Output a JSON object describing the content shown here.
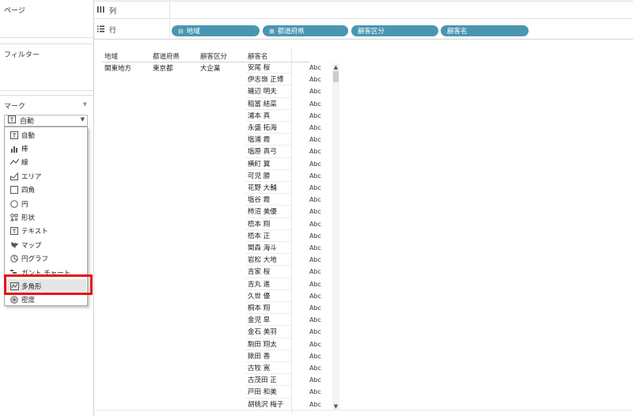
{
  "left_pane": {
    "pages_title": "ページ",
    "filters_title": "フィルター",
    "marks_title": "マーク",
    "mark_type": {
      "label": "自動",
      "icon": "text-icon"
    },
    "dropdown_items": [
      {
        "label": "自動",
        "icon": "text-icon"
      },
      {
        "label": "棒",
        "icon": "bar-icon"
      },
      {
        "label": "線",
        "icon": "line-icon"
      },
      {
        "label": "エリア",
        "icon": "area-icon"
      },
      {
        "label": "四角",
        "icon": "square-icon"
      },
      {
        "label": "円",
        "icon": "circle-icon"
      },
      {
        "label": "形状",
        "icon": "shape-icon"
      },
      {
        "label": "テキスト",
        "icon": "text-icon"
      },
      {
        "label": "マップ",
        "icon": "map-icon"
      },
      {
        "label": "円グラフ",
        "icon": "pie-icon"
      },
      {
        "label": "ガント チャート",
        "icon": "gantt-icon"
      },
      {
        "label": "多角形",
        "icon": "polygon-icon",
        "highlighted": true
      },
      {
        "label": "密度",
        "icon": "density-icon"
      }
    ]
  },
  "shelves": {
    "columns_label": "列",
    "rows_label": "行",
    "row_pills": [
      {
        "label": "地域",
        "icon": "⊟"
      },
      {
        "label": "都道府県",
        "icon": "⊞"
      },
      {
        "label": "顧客区分",
        "icon": ""
      },
      {
        "label": "顧客名",
        "icon": ""
      }
    ]
  },
  "table": {
    "headers": [
      "地域",
      "都道府県",
      "顧客区分",
      "顧客名"
    ],
    "region": "関東地方",
    "prefecture": "東京都",
    "segment": "大企業",
    "cell_text": "Abc",
    "customers": [
      "安尾 桜",
      "伊志嶺 正博",
      "磯辺 明夫",
      "稲冨 結菜",
      "浦本 真",
      "永盛 拓海",
      "塩浦 霞",
      "塩原 真弓",
      "横町 翼",
      "可児 勝",
      "花野 大輔",
      "塩谷 霞",
      "柿沼 美優",
      "梧本 翔",
      "梧本 正",
      "関森 海斗",
      "岩松 大地",
      "吉家 桜",
      "吉丸 進",
      "久世 優",
      "桐本 翔",
      "金児 皐",
      "金石 美羽",
      "駒田 翔太",
      "鍬田 香",
      "古牧 寛",
      "古茂田 正",
      "戸田 和美",
      "胡桃沢 梅子"
    ]
  },
  "colors": {
    "pill": "#4996b2",
    "highlight": "#e8101a"
  }
}
